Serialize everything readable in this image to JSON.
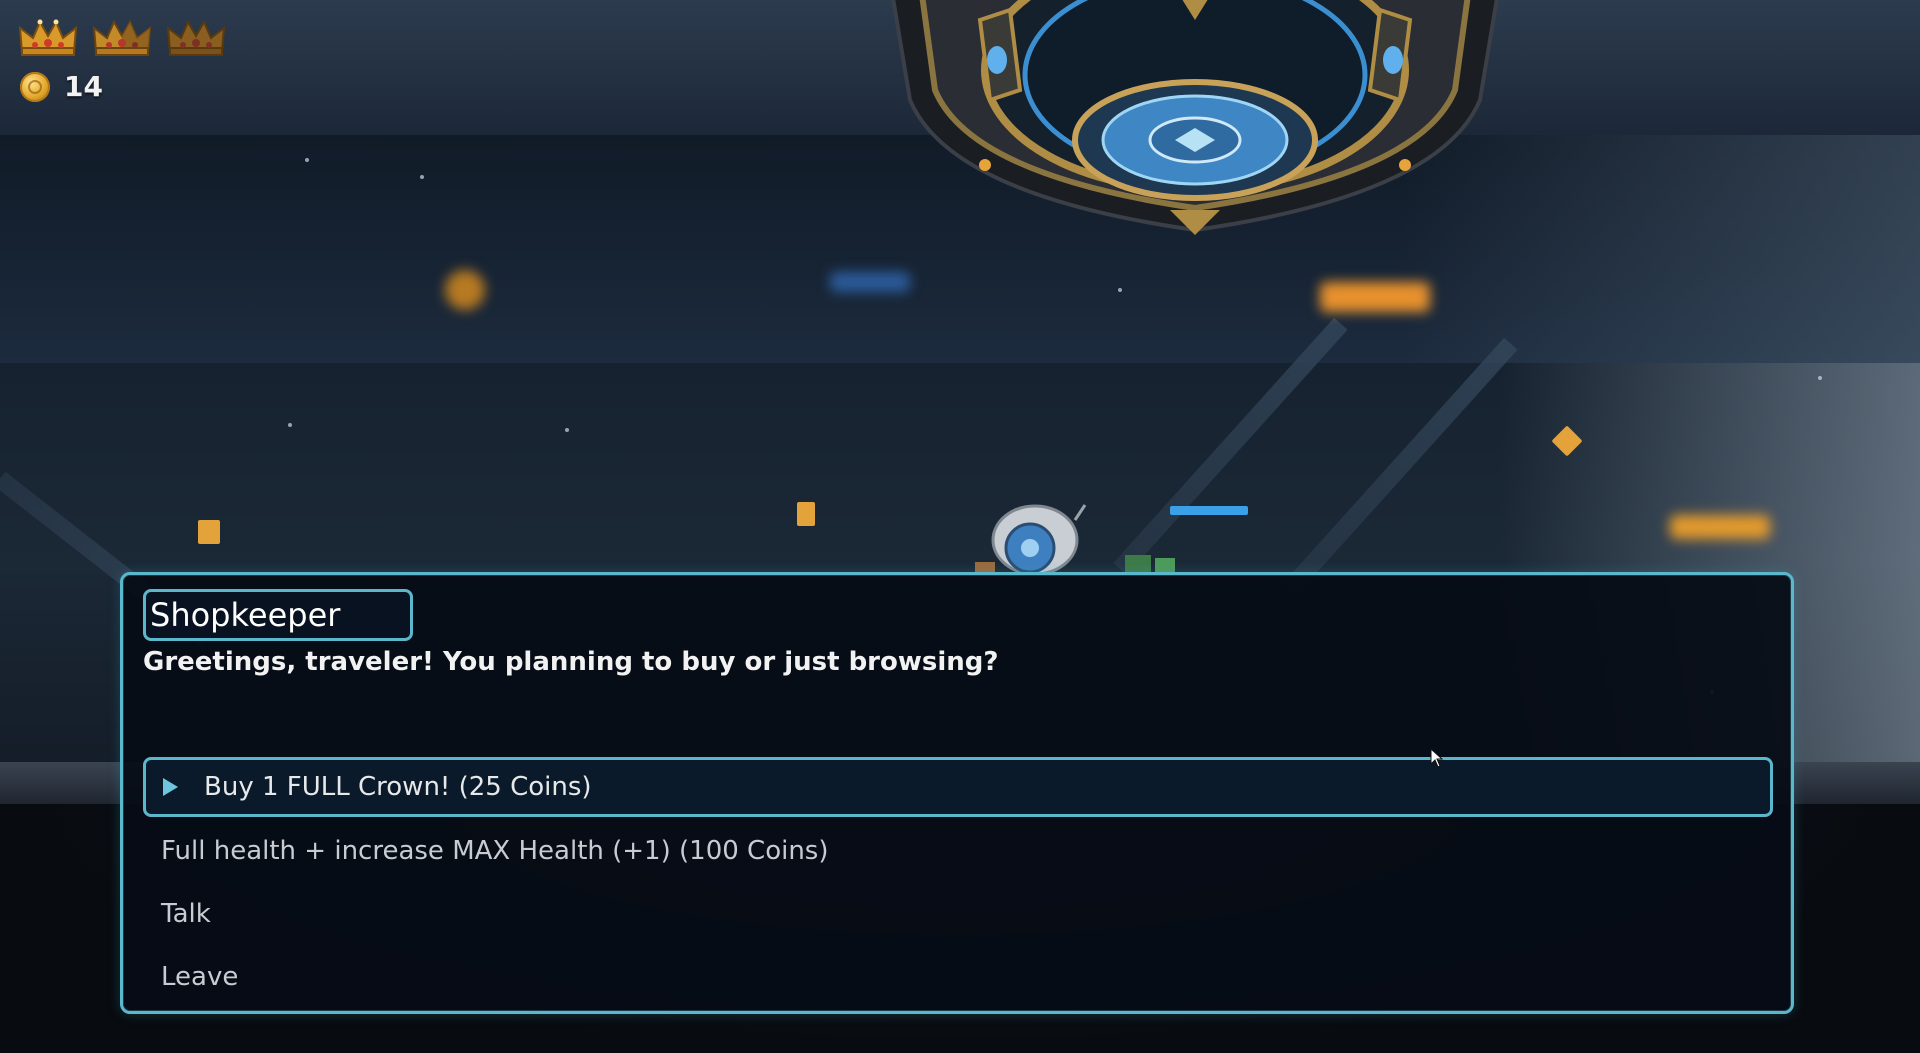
{
  "hud": {
    "crowns": [
      {
        "icon": "crown-icon",
        "state": "full"
      },
      {
        "icon": "crown-icon",
        "state": "partial"
      },
      {
        "icon": "crown-icon",
        "state": "empty"
      }
    ],
    "coins": "14"
  },
  "dialog": {
    "speaker": "Shopkeeper",
    "line": "Greetings, traveler! You planning to buy or just browsing?",
    "choices": [
      {
        "label": "Buy 1 FULL Crown! (25 Coins)",
        "selected": true
      },
      {
        "label": "Full health + increase MAX Health (+1) (100 Coins)",
        "selected": false
      },
      {
        "label": "Talk",
        "selected": false
      },
      {
        "label": "Leave",
        "selected": false
      }
    ]
  },
  "colors": {
    "dialog_border": "#5bb8cc",
    "dialog_background": "#060c16",
    "gold": "#e2a72a"
  }
}
